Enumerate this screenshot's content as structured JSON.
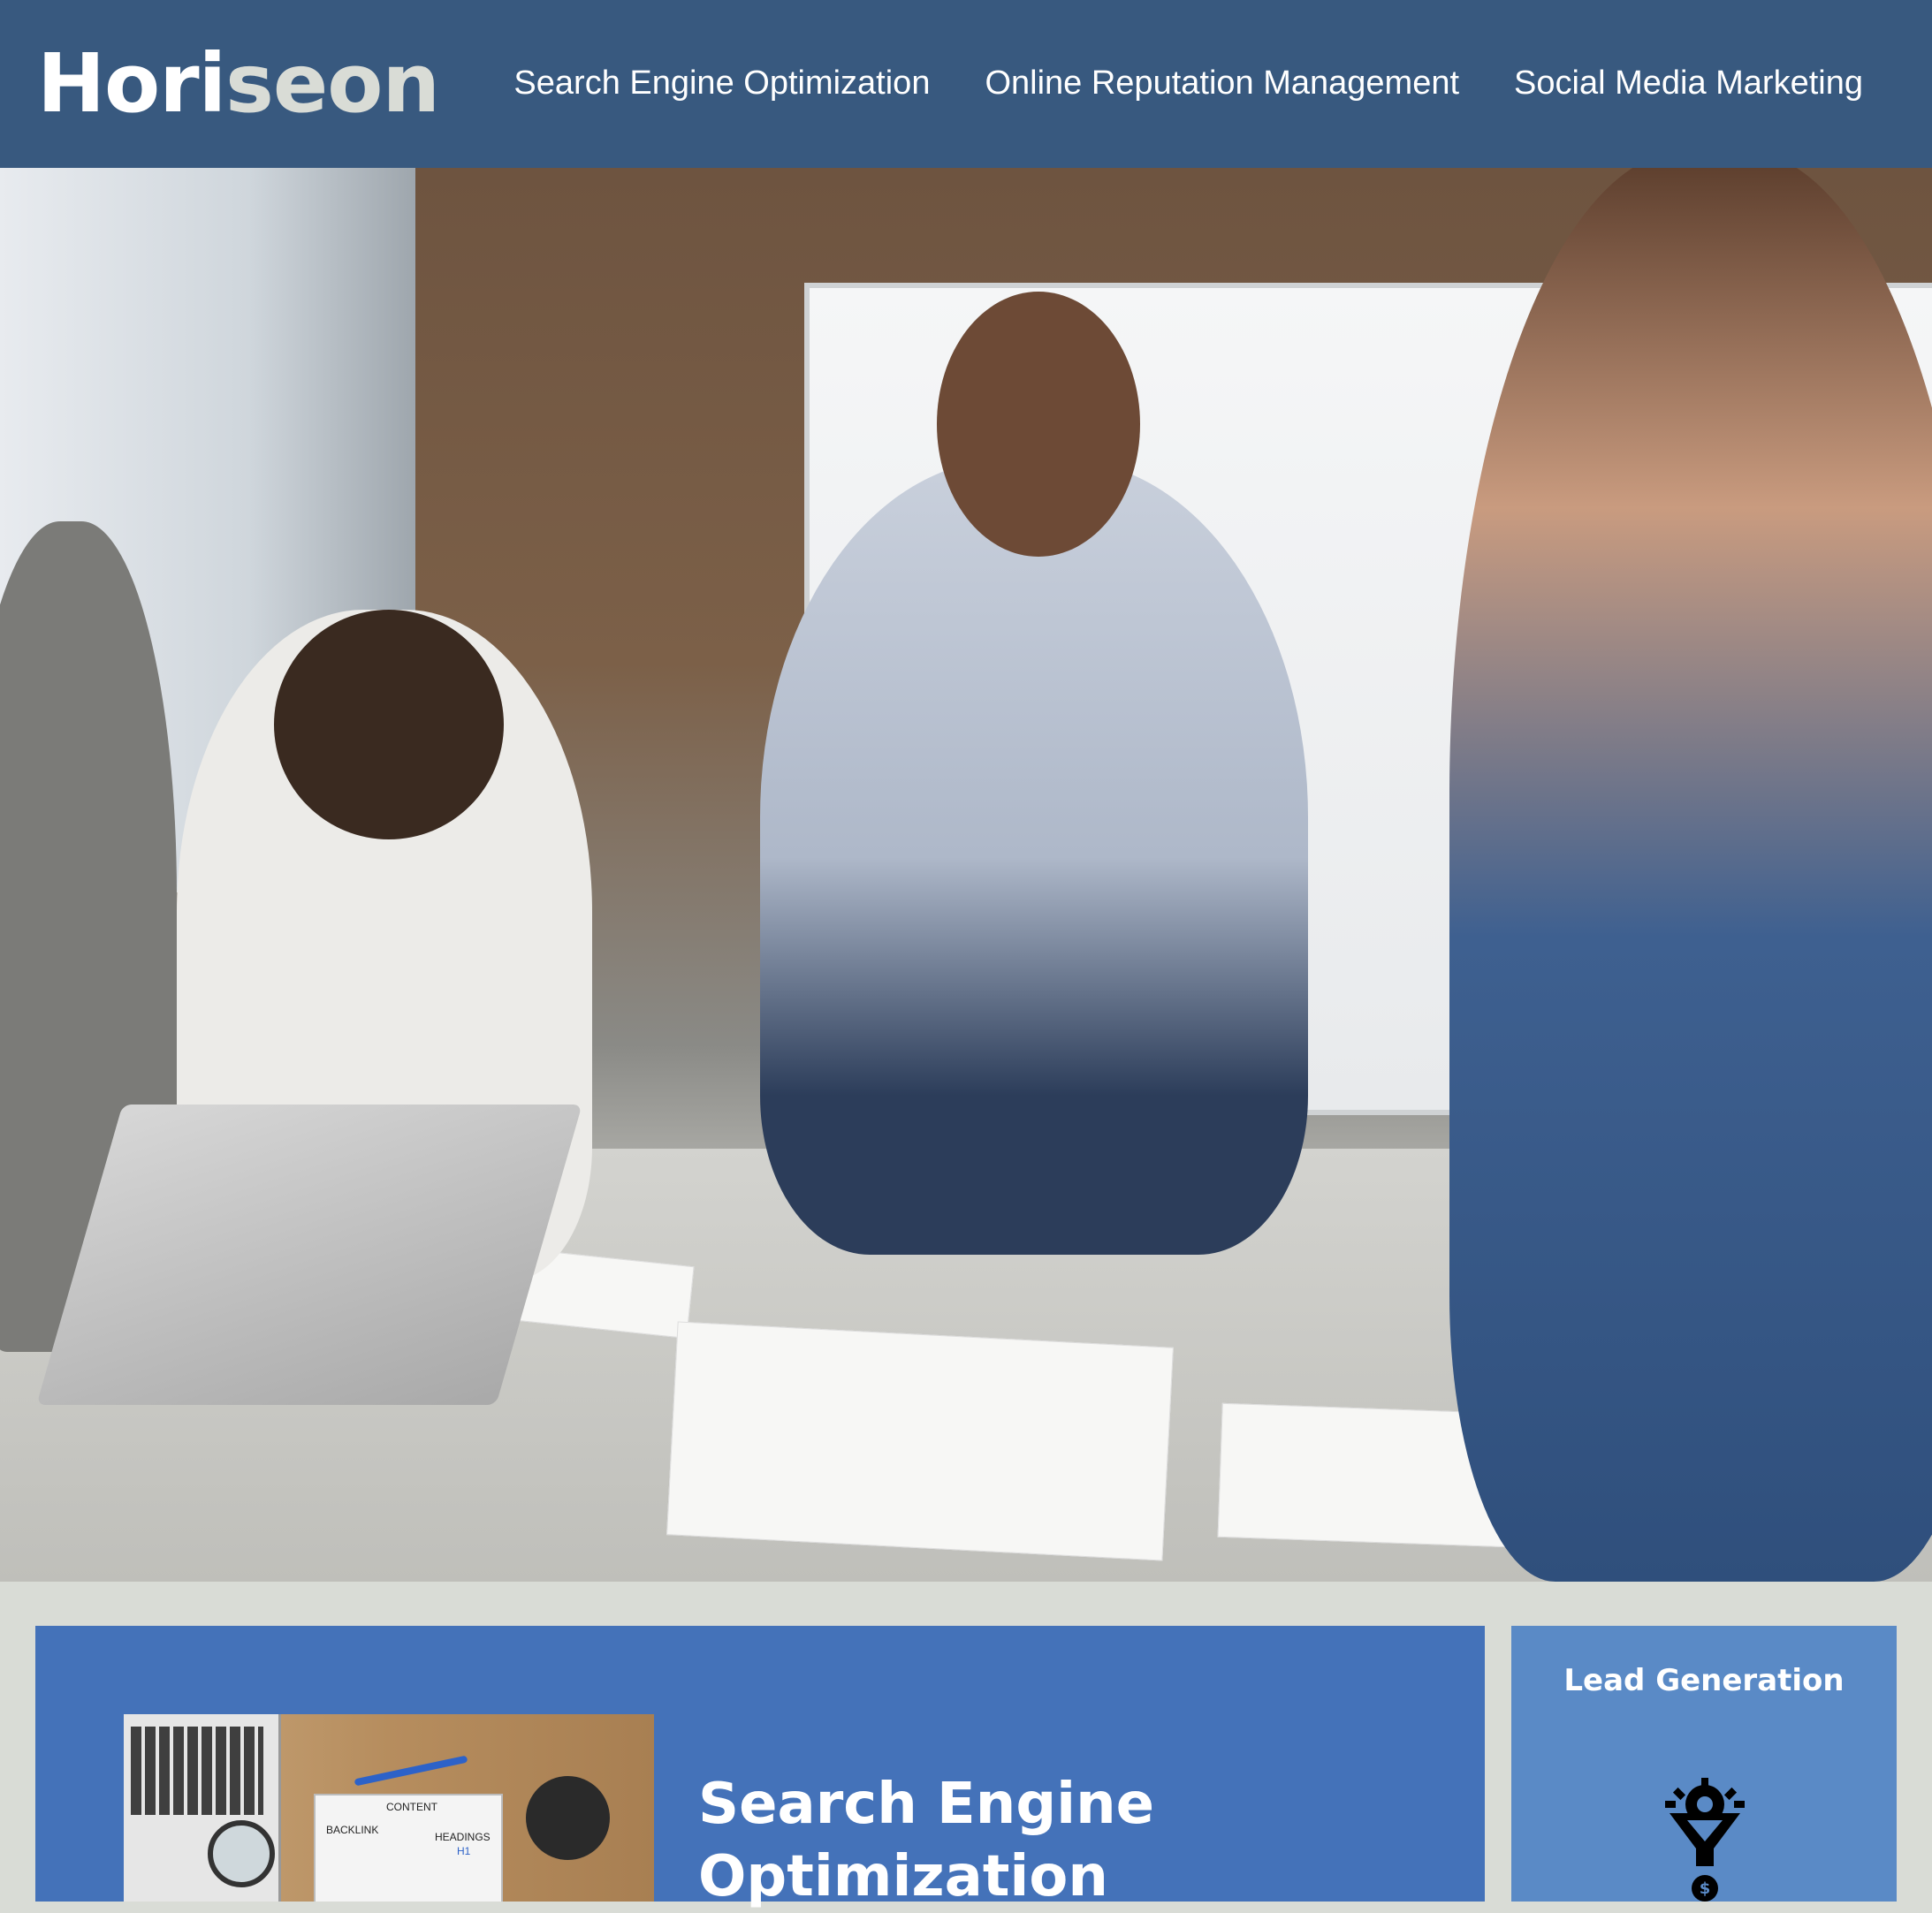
{
  "header": {
    "logo": {
      "part1": "Hori",
      "part2": "seon"
    },
    "nav": [
      {
        "label": "Search Engine Optimization"
      },
      {
        "label": "Online Reputation Management"
      },
      {
        "label": "Social Media Marketing"
      }
    ]
  },
  "hero": {
    "image": "business-team-meeting-photo"
  },
  "main": {
    "sections": [
      {
        "title": "Search Engine Optimization",
        "image": "seo-illustration",
        "image_text": {
          "content": "CONTENT",
          "backlink": "BACKLINK",
          "headings": "HEADINGS",
          "hi": "H1"
        }
      }
    ]
  },
  "sidebar": {
    "items": [
      {
        "title": "Lead Generation",
        "icon": "lead-generation-funnel-icon"
      }
    ]
  },
  "colors": {
    "header_bg": "#38597f",
    "content_bg": "#4472b9",
    "sidebar_bg": "#5a8ac6",
    "page_bg": "#d9dcd6",
    "logo_accent": "#d9dcd6"
  }
}
